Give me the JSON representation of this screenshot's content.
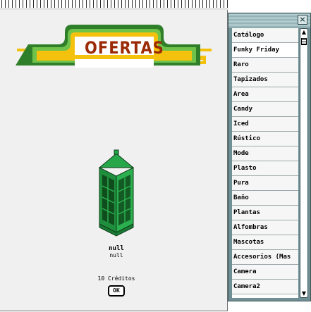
{
  "banner": {
    "title": "OFERTAS"
  },
  "product": {
    "name": "null",
    "description": "null",
    "price": "10 Créditos"
  },
  "buttons": {
    "ok_label": "OK",
    "close_label": "×"
  },
  "catalog": {
    "selected_index": 1,
    "items": [
      {
        "label": "Catálogo"
      },
      {
        "label": "Funky Friday"
      },
      {
        "label": "Raro"
      },
      {
        "label": "Tapizados"
      },
      {
        "label": "Area"
      },
      {
        "label": "Candy"
      },
      {
        "label": "Iced"
      },
      {
        "label": "Rústico"
      },
      {
        "label": "Mode"
      },
      {
        "label": "Plasto"
      },
      {
        "label": "Pura"
      },
      {
        "label": "Baño"
      },
      {
        "label": "Plantas"
      },
      {
        "label": "Alfombras"
      },
      {
        "label": "Mascotas"
      },
      {
        "label": "Accesorios (Mas"
      },
      {
        "label": "Camera"
      },
      {
        "label": "Camera2"
      }
    ]
  },
  "colors": {
    "banner_green_dark": "#2f7f2a",
    "banner_green_light": "#6fc24a",
    "banner_yellow": "#f4c20d",
    "banner_text": "#9b2a06",
    "booth_green": "#239a43"
  },
  "icons": {
    "product": "phone-booth-icon",
    "close": "close-icon",
    "scroll_up": "arrow-up-icon",
    "scroll_down": "arrow-down-icon"
  }
}
